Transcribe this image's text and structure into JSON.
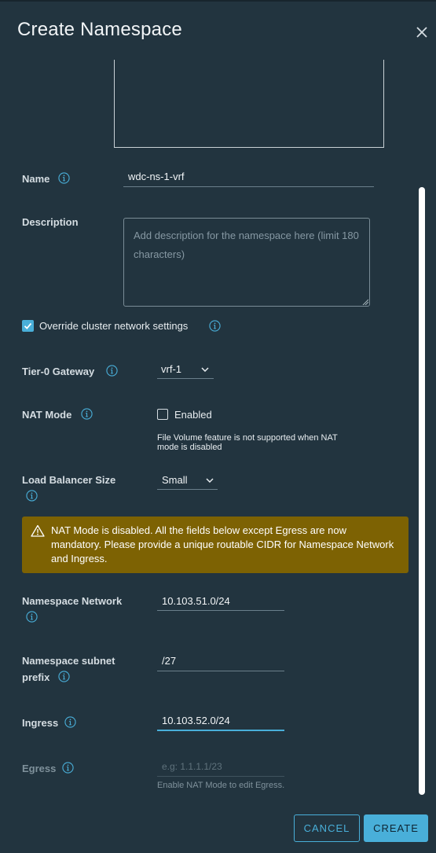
{
  "dialog": {
    "title": "Create Namespace"
  },
  "form": {
    "name_label": "Name",
    "name_value": "wdc-ns-1-vrf",
    "description_label": "Description",
    "description_placeholder": "Add description for the namespace here (limit 180 characters)",
    "override_label": "Override cluster network settings",
    "override_checked": true,
    "tier0_label": "Tier-0 Gateway",
    "tier0_value": "vrf-1",
    "nat_label": "NAT Mode",
    "nat_enabled_label": "Enabled",
    "nat_checked": false,
    "nat_note": "File Volume feature is not supported when NAT mode is disabled",
    "lb_label": "Load Balancer Size",
    "lb_value": "Small",
    "alert_text": "NAT Mode is disabled. All the fields below except Egress are now mandatory. Please provide a unique routable CIDR for Namespace Network and Ingress.",
    "ns_network_label": "Namespace Network",
    "ns_network_value": "10.103.51.0/24",
    "ns_subnet_label_1": "Namespace subnet",
    "ns_subnet_label_2": "prefix",
    "ns_subnet_value": "/27",
    "ingress_label": "Ingress",
    "ingress_value": "10.103.52.0/24",
    "egress_label": "Egress",
    "egress_placeholder": "e.g: 1.1.1.1/23",
    "egress_note": "Enable NAT Mode to edit Egress."
  },
  "footer": {
    "cancel_label": "CANCEL",
    "create_label": "CREATE"
  },
  "colors": {
    "background": "#22343f",
    "accent": "#49afd9",
    "warning": "#7d6203"
  },
  "icons": [
    "close-icon",
    "info-icon",
    "checkmark-icon",
    "chevron-down-icon",
    "warning-icon"
  ]
}
